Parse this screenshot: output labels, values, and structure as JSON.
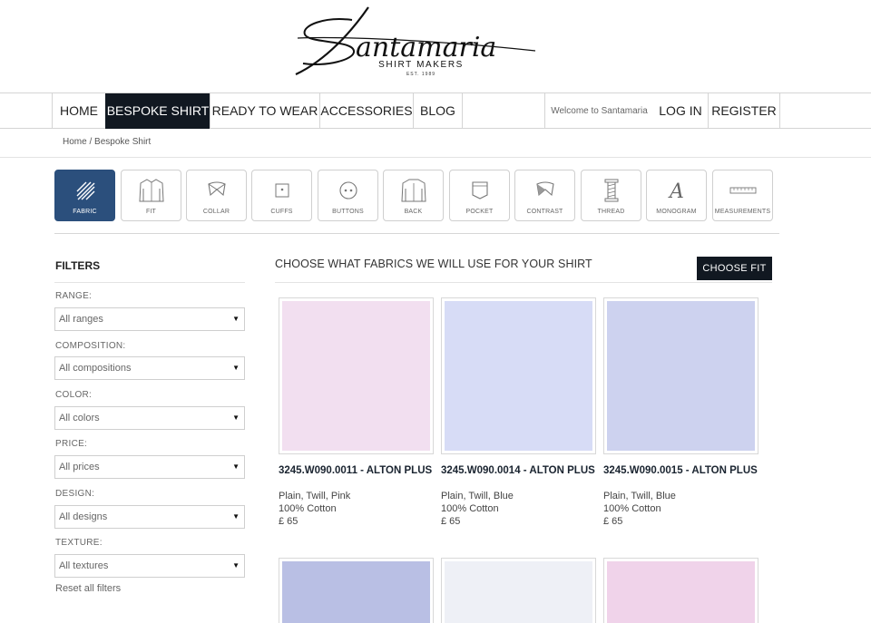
{
  "brand": {
    "name": "Santamaria",
    "tagline": "SHIRT MAKERS",
    "est": "EST. 1989"
  },
  "nav": {
    "items": [
      {
        "label": "HOME"
      },
      {
        "label": "BESPOKE SHIRT"
      },
      {
        "label": "READY TO WEAR"
      },
      {
        "label": "ACCESSORIES"
      },
      {
        "label": "BLOG"
      }
    ],
    "welcome": "Welcome to Santamaria",
    "login": "LOG IN",
    "register": "REGISTER"
  },
  "breadcrumb": {
    "home": "Home",
    "separator": " / ",
    "current": "Bespoke Shirt"
  },
  "steps": [
    {
      "label": "FABRIC",
      "icon": "fabric-icon",
      "active": true
    },
    {
      "label": "FIT",
      "icon": "shirt-fit-icon"
    },
    {
      "label": "COLLAR",
      "icon": "collar-icon"
    },
    {
      "label": "CUFFS",
      "icon": "cuff-icon"
    },
    {
      "label": "BUTTONS",
      "icon": "button-icon"
    },
    {
      "label": "BACK",
      "icon": "shirt-back-icon"
    },
    {
      "label": "POCKET",
      "icon": "pocket-icon"
    },
    {
      "label": "CONTRAST",
      "icon": "contrast-icon"
    },
    {
      "label": "THREAD",
      "icon": "thread-spool-icon"
    },
    {
      "label": "MONOGRAM",
      "icon": "monogram-icon"
    },
    {
      "label": "MEASUREMENTS",
      "icon": "ruler-icon"
    }
  ],
  "filters": {
    "title": "FILTERS",
    "groups": [
      {
        "label": "RANGE:",
        "value": "All ranges"
      },
      {
        "label": "COMPOSITION:",
        "value": "All compositions"
      },
      {
        "label": "COLOR:",
        "value": "All colors"
      },
      {
        "label": "PRICE:",
        "value": "All prices"
      },
      {
        "label": "DESIGN:",
        "value": "All designs"
      },
      {
        "label": "TEXTURE:",
        "value": "All textures"
      }
    ],
    "reset": "Reset all filters"
  },
  "content": {
    "title": "CHOOSE WHAT FABRICS WE WILL USE FOR YOUR SHIRT",
    "choose_fit": "CHOOSE FIT"
  },
  "products": [
    {
      "name": "3245.W090.0011 - ALTON PLUS",
      "desc": "Plain, Twill, Pink",
      "composition": "100% Cotton",
      "price": "£ 65",
      "color": "#f2dff0"
    },
    {
      "name": "3245.W090.0014 - ALTON PLUS",
      "desc": "Plain, Twill, Blue",
      "composition": "100% Cotton",
      "price": "£ 65",
      "color": "#d7dcf6"
    },
    {
      "name": "3245.W090.0015 - ALTON PLUS",
      "desc": "Plain, Twill, Blue",
      "composition": "100% Cotton",
      "price": "£ 65",
      "color": "#cdd2ef"
    }
  ],
  "products_row2": [
    {
      "color": "#b9bfe4"
    },
    {
      "color": "#eef0f6"
    },
    {
      "color": "#f0d3ea"
    }
  ],
  "colors": {
    "nav_active": "#111821",
    "step_active": "#2b4f7c"
  }
}
